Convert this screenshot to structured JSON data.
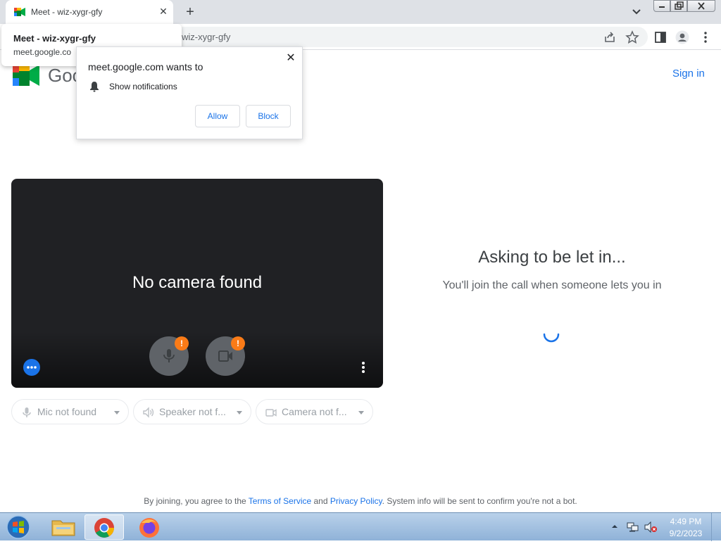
{
  "browser": {
    "tab_title": "Meet - wiz-xygr-gfy",
    "tab_close": "✕",
    "new_tab": "+",
    "url": "wiz-xygr-gfy",
    "hover_card": {
      "title": "Meet - wiz-xygr-gfy",
      "url": "meet.google.co"
    }
  },
  "permission_popup": {
    "title": "meet.google.com wants to",
    "close": "✕",
    "request": "Show notifications",
    "allow_label": "Allow",
    "block_label": "Block"
  },
  "header": {
    "logo_text": "Goo",
    "sign_in": "Sign in"
  },
  "preview": {
    "message": "No camera found",
    "mic_warning": "!",
    "camera_warning": "!"
  },
  "devices": [
    {
      "label": "Mic not found",
      "icon": "mic-icon"
    },
    {
      "label": "Speaker not f...",
      "icon": "speaker-icon"
    },
    {
      "label": "Camera not f...",
      "icon": "camera-icon"
    }
  ],
  "status": {
    "title": "Asking to be let in...",
    "subtitle": "You'll join the call when someone lets you in"
  },
  "footer": {
    "prefix": "By joining, you agree to the ",
    "terms": "Terms of Service",
    "and": " and ",
    "privacy": "Privacy Policy",
    "suffix": ". System info will be sent to confirm you're not a bot."
  },
  "taskbar": {
    "time": "4:49 PM",
    "date": "9/2/2023"
  },
  "colors": {
    "accent": "#1a73e8",
    "warning": "#fa7b17",
    "video_bg": "#202124"
  }
}
